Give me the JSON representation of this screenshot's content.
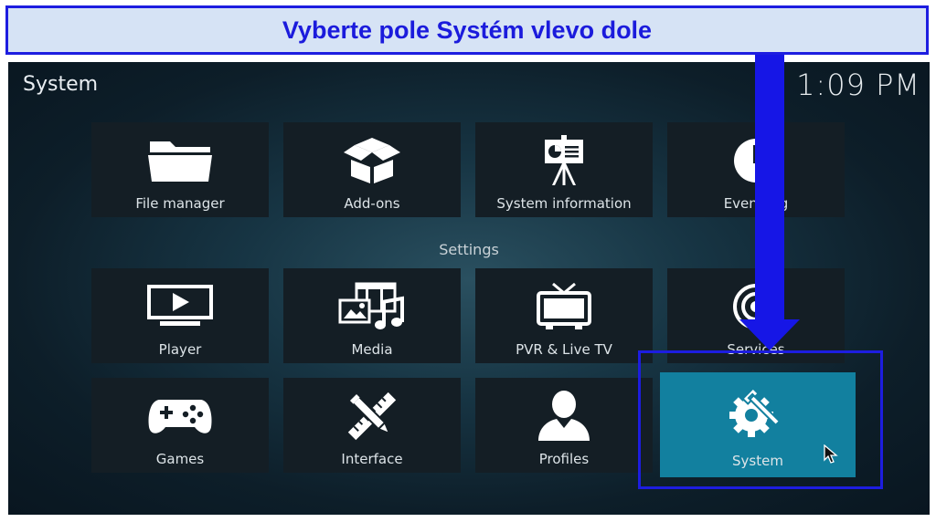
{
  "banner": {
    "text": "Vyberte pole Systém vlevo dole"
  },
  "header": {
    "title": "System",
    "clock": "1:09 PM"
  },
  "top_row": [
    {
      "label": "File manager",
      "icon": "folder-icon"
    },
    {
      "label": "Add-ons",
      "icon": "open-box-icon"
    },
    {
      "label": "System information",
      "icon": "presentation-board-icon"
    },
    {
      "label": "Event log",
      "icon": "clock-icon"
    }
  ],
  "settings": {
    "heading": "Settings",
    "items": [
      {
        "label": "Player",
        "icon": "tv-play-icon"
      },
      {
        "label": "Media",
        "icon": "media-icon"
      },
      {
        "label": "PVR & Live TV",
        "icon": "tv-antenna-icon"
      },
      {
        "label": "Services",
        "icon": "wireless-icon"
      },
      {
        "label": "Games",
        "icon": "gamepad-icon"
      },
      {
        "label": "Interface",
        "icon": "pencil-ruler-icon"
      },
      {
        "label": "Profiles",
        "icon": "person-icon"
      },
      {
        "label": "System",
        "icon": "gear-wrench-icon",
        "selected": true
      }
    ]
  },
  "colors": {
    "annotation_blue": "#1d1de0",
    "banner_bg": "#d6e3f5",
    "selected_tile": "#12809f",
    "tile_bg": "#141e25"
  }
}
